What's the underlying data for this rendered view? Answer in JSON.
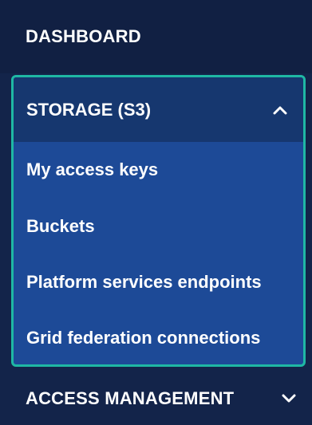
{
  "nav": {
    "dashboard_label": "DASHBOARD",
    "storage": {
      "label": "STORAGE (S3)",
      "expanded": true,
      "items": [
        {
          "label": "My access keys"
        },
        {
          "label": "Buckets"
        },
        {
          "label": "Platform services endpoints"
        },
        {
          "label": "Grid federation connections"
        }
      ]
    },
    "access_management_label": "ACCESS MANAGEMENT"
  },
  "colors": {
    "nav_background": "#13244a",
    "group_header_background": "#16376f",
    "submenu_background": "#1d4a97",
    "focus_outline": "#1fb8a4",
    "text": "#ffffff"
  },
  "icons": {
    "storage_toggle": "chevron-up-icon",
    "access_management_toggle": "chevron-down-icon"
  }
}
